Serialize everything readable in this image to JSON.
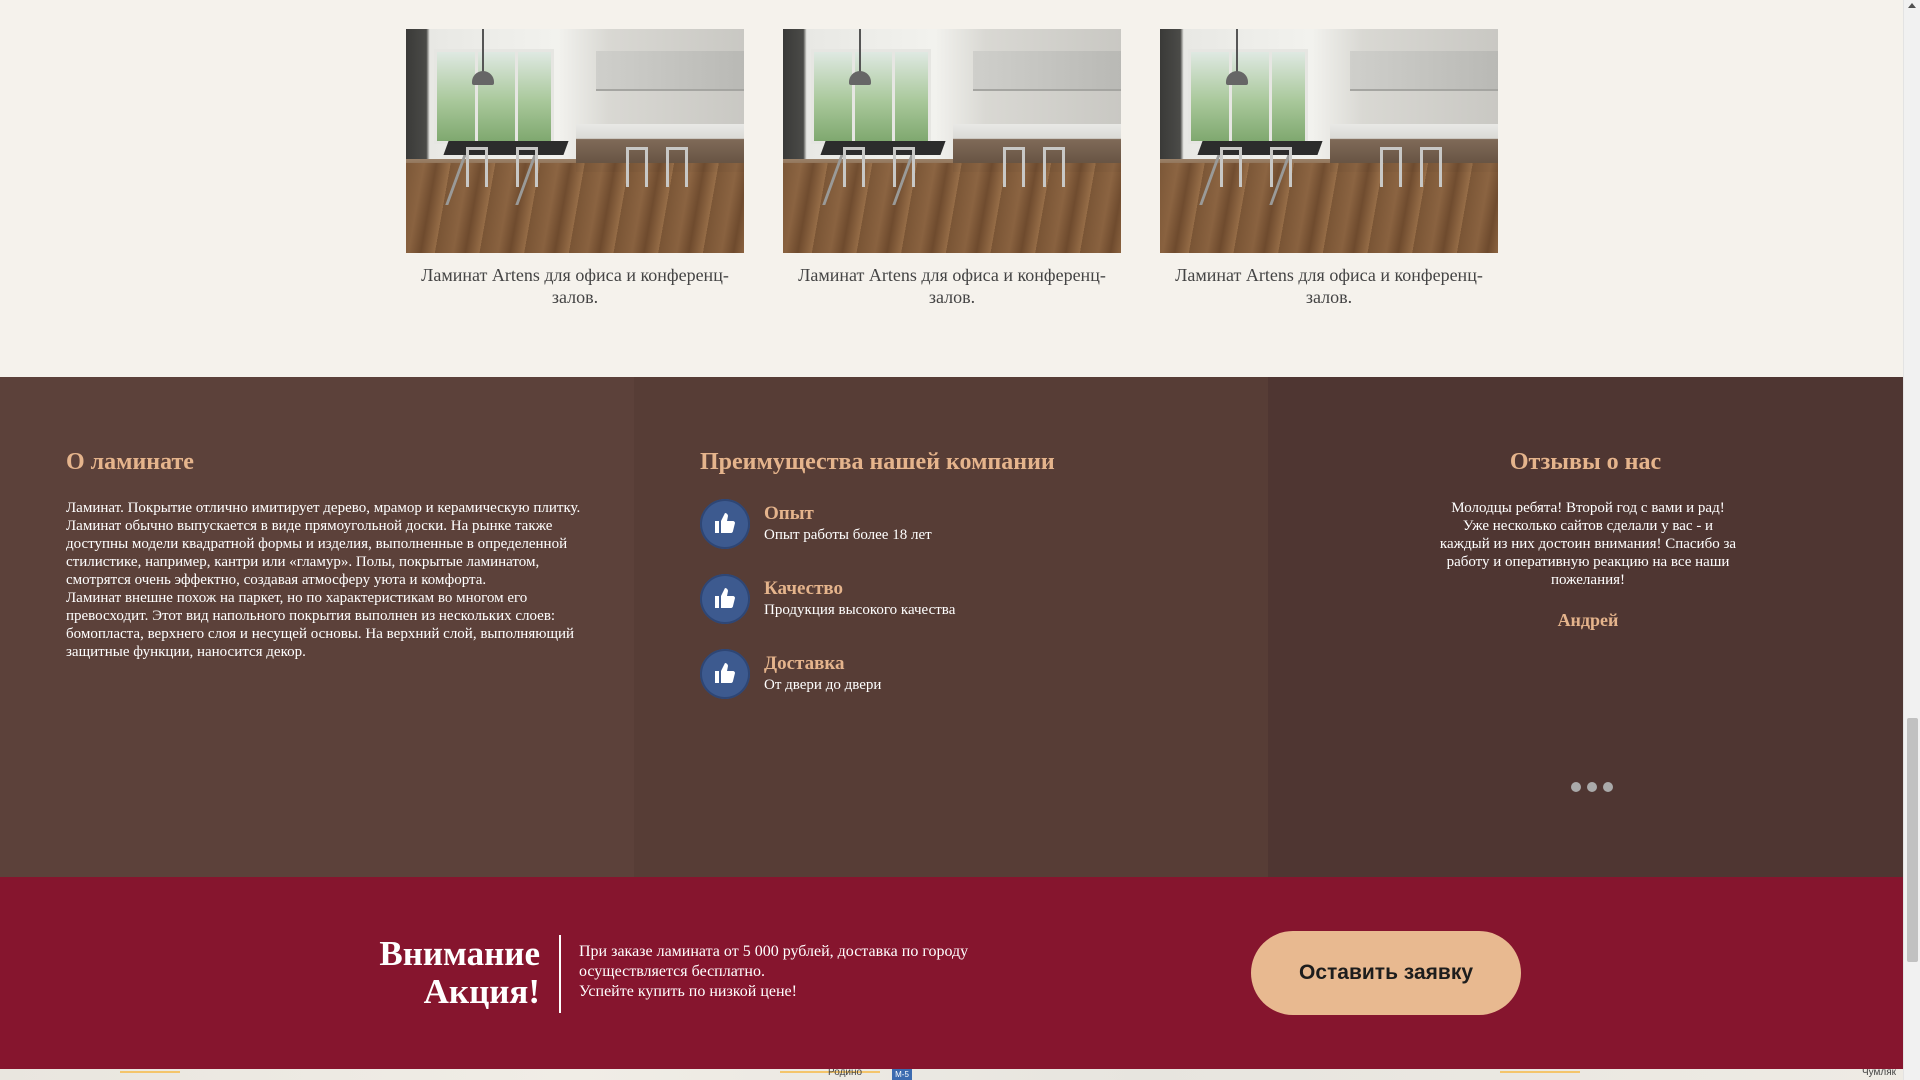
{
  "gallery": {
    "items": [
      {
        "caption": "Ламинат Artens для офиса и конференц-залов.",
        "image": "kitchen-interior-photo"
      },
      {
        "caption": "Ламинат Artens для офиса и конференц-залов.",
        "image": "kitchen-interior-photo"
      },
      {
        "caption": "Ламинат Artens для офиса и конференц-залов.",
        "image": "kitchen-interior-photo"
      }
    ]
  },
  "about": {
    "title": "О ламинате",
    "text": "Ламинат. Покрытие отлично имитирует дерево, мрамор и керамическую плитку. Ламинат обычно выпускается в виде прямоугольной доски. На рынке также доступны модели квадратной формы и изделия, выполненные в определенной стилистике, например, кантри или «гламур». Полы, покрытые ламинатом, смотрятся очень эффектно, создавая атмосферу уюта и комфорта.",
    "text2": "Ламинат внешне похож на паркет, но по характеристикам во многом его превосходит. Этот вид напольного покрытия выполнен из нескольких слоев: бомопласта, верхнего слоя и несущей основы. На верхний слой, выполняющий защитные функции, наносится декор."
  },
  "advantages": {
    "title": "Преимущества нашей компании",
    "items": [
      {
        "title": "Опыт",
        "text": "Опыт работы более 18 лет",
        "icon": "thumbs-up-icon"
      },
      {
        "title": "Качество",
        "text": "Продукция высокого качества",
        "icon": "thumbs-up-icon"
      },
      {
        "title": "Доставка",
        "text": "От двери до двери",
        "icon": "thumbs-up-icon"
      }
    ]
  },
  "reviews": {
    "title": "Отзывы о нас",
    "text": "Молодцы ребята! Второй год с вами и рад! Уже несколько сайтов сделали у вас - и каждый из них достоин внимания! Спасибо за работу и оперативную реакцию на все наши пожелания!",
    "author": "Андрей",
    "slides": 3
  },
  "promo": {
    "heading_line1": "Внимание",
    "heading_line2": "Акция!",
    "text_line1": "При заказе ламината от 5 000 рублей, доставка по городу осуществляется бесплатно.",
    "text_line2": "Успейте купить по низкой цене!",
    "button_label": "Оставить заявку"
  },
  "map": {
    "label_left": "Родино",
    "road_sign": "М-5",
    "label_right": "Чумляк"
  },
  "colors": {
    "accent": "#e5b48c",
    "promo_bg": "#86152e",
    "info_bg": "#573d36",
    "gallery_bg": "#f5f2ec"
  }
}
